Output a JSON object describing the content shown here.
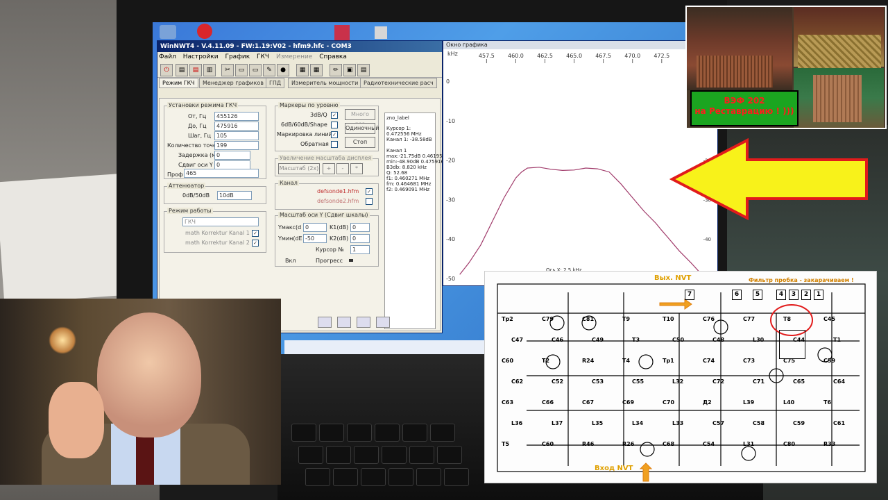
{
  "app": {
    "title": "WinNWT4 - V.4.11.09 - FW:1.19:V02 - hfm9.hfc - COM3",
    "menu": [
      "Файл",
      "Настройки",
      "График",
      "ГКЧ",
      "Измерение",
      "Справка"
    ],
    "tabs": [
      "Режим ГКЧ",
      "Менеджер графиков",
      "ГПД",
      "Измеритель мощности",
      "Радиотехнические расч"
    ],
    "sweep": {
      "group_title": "Установки режима ГКЧ",
      "from_label": "От, Гц",
      "from_value": "455126",
      "to_label": "До, Гц",
      "to_value": "475916",
      "step_label": "Шаг, Гц",
      "step_value": "105",
      "points_label": "Количество точек",
      "points_value": "199",
      "delay_label": "Задержка (мс)",
      "delay_value": "0",
      "shift_label": "Сдвиг оси Y",
      "shift_value": "0",
      "profile_label": "Проф",
      "profile_value": "465"
    },
    "attenuator": {
      "group_title": "Аттенюатор",
      "label": "0dB/50dB",
      "value": "10dB"
    },
    "mode": {
      "group_title": "Режим работы",
      "value": "ГКЧ",
      "math1": "math  Korrektur Kanal 1",
      "math2": "math  Korrektur Kanal 2"
    },
    "markers": {
      "group_title": "Маркеры по уровню",
      "items": [
        "3dB/Q",
        "6dB/60dB/Shape",
        "Маркировка линий",
        "Обратная"
      ],
      "btn_multi": "Много раз",
      "btn_once": "Одиночный",
      "btn_stop": "Стоп"
    },
    "zoom": {
      "group_title": "Увеличение масштаба дисплея",
      "label": "Масштаб (2x)",
      "btn_plus": "+",
      "btn_minus": "-",
      "btn_reset": "*"
    },
    "channel": {
      "group_title": "Канал",
      "file1": "defsonde1.hfm",
      "file2": "defsonde2.hfm"
    },
    "yscale": {
      "group_title": "Масштаб оси Y (Сдвиг шкалы)",
      "ymax_label": "Yмакс(d",
      "ymax_value": "0",
      "ymin_label": "Yмин(dE",
      "ymin_value": "-50",
      "k1_label": "K1(dB)",
      "k1_value": "0",
      "k2_label": "K2(dB)",
      "k2_value": "0",
      "cursor_label": "Курсор №",
      "cursor_value": "1",
      "on_label": "Вкл",
      "progress_label": "Прогресс"
    },
    "info_panel": {
      "name": "zno_label",
      "lines": [
        "Курсор 1:",
        "0.472556 MHz",
        "Канал 1: -38.58dB",
        "",
        "Канал 1",
        "max:-21.75dB 0.461951M",
        "min:-48.90dB 0.475916M",
        "B3db: 8.820 kHz",
        "Q: 52.68",
        "f1: 0.460271 MHz",
        "fm: 0.464681 MHz",
        "f2: 0.469091 MHz"
      ]
    }
  },
  "graph_window": {
    "title": "Окно графика",
    "x_unit": "kHz",
    "x_ticks": [
      "457.5",
      "460.0",
      "462.5",
      "465.0",
      "467.5",
      "470.0",
      "472.5"
    ],
    "y_ticks": [
      "0",
      "-10",
      "-20",
      "-30",
      "-40",
      "-50"
    ],
    "y_ticks_right": [
      "0",
      "-10",
      "-20",
      "-30",
      "-40",
      "-50"
    ],
    "footer": "Ось X: 2.5 kHz",
    "trace_color": "#a03a6a"
  },
  "chart_data": {
    "type": "line",
    "title": "",
    "xlabel": "kHz",
    "ylabel": "",
    "xlim": [
      455.1,
      475.9
    ],
    "ylim": [
      -50,
      0
    ],
    "grid": false,
    "series": [
      {
        "x": [
          455.2,
          456.0,
          457.0,
          458.0,
          459.0,
          460.0,
          460.5,
          461.0,
          462.0,
          463.0,
          464.0,
          465.0,
          466.0,
          467.0,
          468.0,
          468.5,
          469.0,
          470.0,
          471.0,
          472.0,
          472.5,
          473.0,
          474.0,
          475.0,
          475.9
        ],
        "y": [
          -49.0,
          -46.0,
          -41.5,
          -35.5,
          -29.5,
          -24.5,
          -23.0,
          -22.0,
          -21.8,
          -22.3,
          -22.6,
          -22.5,
          -22.0,
          -22.2,
          -23.0,
          -24.5,
          -26.0,
          -29.5,
          -33.0,
          -36.0,
          -37.8,
          -39.5,
          -43.0,
          -46.0,
          -48.9
        ]
      }
    ]
  },
  "desktop": {
    "icons": [
      "recycle-bin",
      "app-red",
      "app-cube",
      "app-generic"
    ]
  },
  "inset_radio": {
    "banner_line1": "ВЭФ 202",
    "banner_line2": "на Реставрацию ! )))",
    "banner_color": "#1ba520",
    "text_color": "#ff1c1c"
  },
  "arrow": {
    "fill": "#f8f21a",
    "stroke": "#e11b1b"
  },
  "schematic": {
    "label_out": "Вых. NVT",
    "label_filter": "Фильтр пробка - закарачиваем !",
    "label_in": "Вход NVT",
    "pins_top": [
      "7",
      "6",
      "5",
      "4",
      "3",
      "2",
      "1"
    ],
    "refs": [
      "Тр2",
      "C79",
      "C81",
      "Т9",
      "Т10",
      "C76",
      "C77",
      "Т8",
      "C45",
      "C47",
      "C46",
      "C49",
      "Т3",
      "C50",
      "C48",
      "L30",
      "C44",
      "T1",
      "C60",
      "T2",
      "R24",
      "T4",
      "Тр1",
      "C74",
      "C73",
      "C75",
      "C59",
      "C62",
      "C52",
      "C53",
      "C55",
      "L32",
      "C72",
      "C71",
      "C65",
      "C64",
      "C63",
      "C66",
      "C67",
      "C69",
      "C70",
      "Д2",
      "L39",
      "L40",
      "Т6",
      "L36",
      "L37",
      "L35",
      "L34",
      "L33",
      "C57",
      "C58",
      "C59",
      "C61",
      "Т5",
      "C60",
      "R46",
      "R26",
      "C68",
      "C54",
      "L31",
      "C80",
      "R33"
    ]
  }
}
